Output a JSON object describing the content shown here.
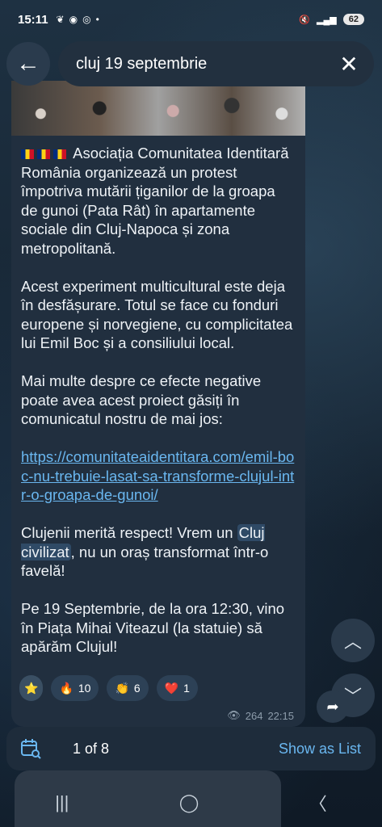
{
  "status": {
    "time": "15:11",
    "battery": "62"
  },
  "search": {
    "query": "cluj 19 septembrie"
  },
  "message": {
    "intro": "Asociația Comunitatea Identitară România organizează un protest împotriva mutării țiganilor de la groapa de gunoi (Pata Rât) în apartamente sociale din Cluj-Napoca și zona metropolitană.",
    "para2": "Acest experiment multicultural este deja în desfășurare. Totul se face cu fonduri europene și norvegiene, cu complicitatea lui Emil Boc și a consiliului local.",
    "para3": "Mai multe despre ce efecte negative poate avea acest proiect găsiți în comunicatul nostru de mai jos:",
    "link": "https://comunitateaidentitara.com/emil-boc-nu-trebuie-lasat-sa-transforme-clujul-intr-o-groapa-de-gunoi/",
    "para4_pre": "Clujenii merită respect! Vrem un ",
    "para4_hl": "Cluj civilizat",
    "para4_post": ", nu un oraș transformat într-o favelă!",
    "para5": "Pe 19 Septembrie, de la ora 12:30, vino în Piața Mihai Viteazul (la statuie) să apărăm Clujul!",
    "views": "264",
    "time": "22:15"
  },
  "reactions": [
    {
      "emoji": "⭐",
      "count": ""
    },
    {
      "emoji": "🔥",
      "count": "10"
    },
    {
      "emoji": "👏",
      "count": "6"
    },
    {
      "emoji": "❤️",
      "count": "1"
    }
  ],
  "bottom": {
    "counter": "1 of 8",
    "list_label": "Show as List"
  }
}
